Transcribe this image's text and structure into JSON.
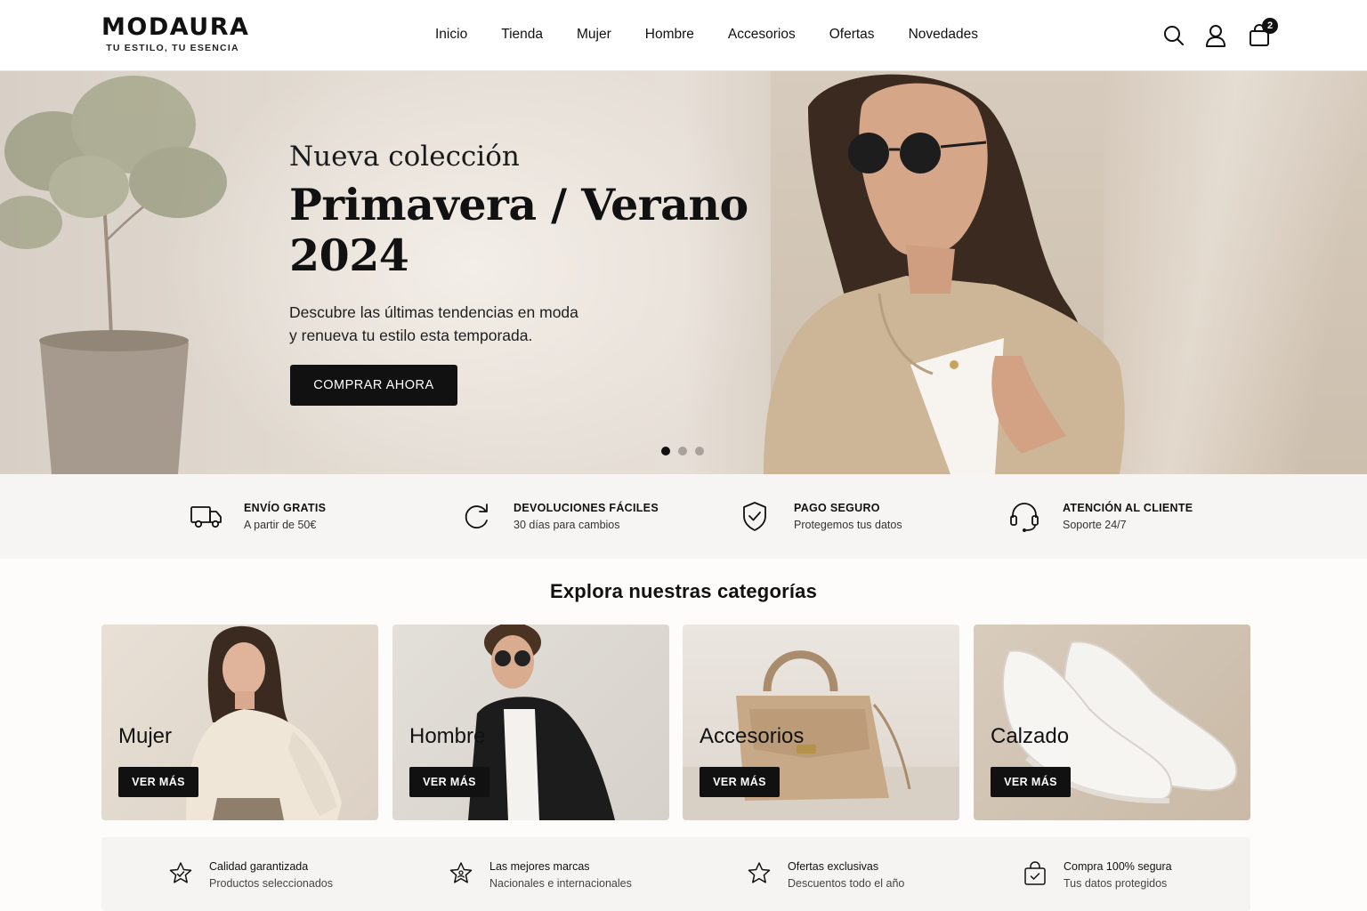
{
  "header": {
    "brand": "MODAURA",
    "tagline": "TU ESTILO, TU ESENCIA",
    "nav": [
      "Inicio",
      "Tienda",
      "Mujer",
      "Hombre",
      "Accesorios",
      "Ofertas",
      "Novedades"
    ],
    "cart_count": "2"
  },
  "hero": {
    "eyebrow": "Nueva colección",
    "title_line1": "Primavera / Verano",
    "title_line2": "2024",
    "desc_line1": "Descubre las últimas tendencias en moda",
    "desc_line2": "y renueva tu estilo esta temporada.",
    "cta": "COMPRAR AHORA"
  },
  "features": [
    {
      "title": "ENVÍO GRATIS",
      "subtitle": "A partir de 50€",
      "icon": "truck-icon"
    },
    {
      "title": "DEVOLUCIONES FÁCILES",
      "subtitle": "30 días para cambios",
      "icon": "refresh-icon"
    },
    {
      "title": "PAGO SEGURO",
      "subtitle": "Protegemos tus datos",
      "icon": "shield-check-icon"
    },
    {
      "title": "ATENCIÓN AL CLIENTE",
      "subtitle": "Soporte 24/7",
      "icon": "headset-icon"
    }
  ],
  "categories": {
    "title": "Explora nuestras categorías",
    "items": [
      {
        "name": "Mujer",
        "cta": "VER MÁS"
      },
      {
        "name": "Hombre",
        "cta": "VER MÁS"
      },
      {
        "name": "Accesorios",
        "cta": "VER MÁS"
      },
      {
        "name": "Calzado",
        "cta": "VER MÁS"
      }
    ]
  },
  "benefits": [
    {
      "title": "Calidad garantizada",
      "subtitle": "Productos seleccionados",
      "icon": "star-badge-icon"
    },
    {
      "title": "Las mejores marcas",
      "subtitle": "Nacionales e internacionales",
      "icon": "star-person-icon"
    },
    {
      "title": "Ofertas exclusivas",
      "subtitle": "Descuentos todo el año",
      "icon": "star-icon"
    },
    {
      "title": "Compra 100% segura",
      "subtitle": "Tus datos protegidos",
      "icon": "shopping-bag-check-icon"
    }
  ]
}
